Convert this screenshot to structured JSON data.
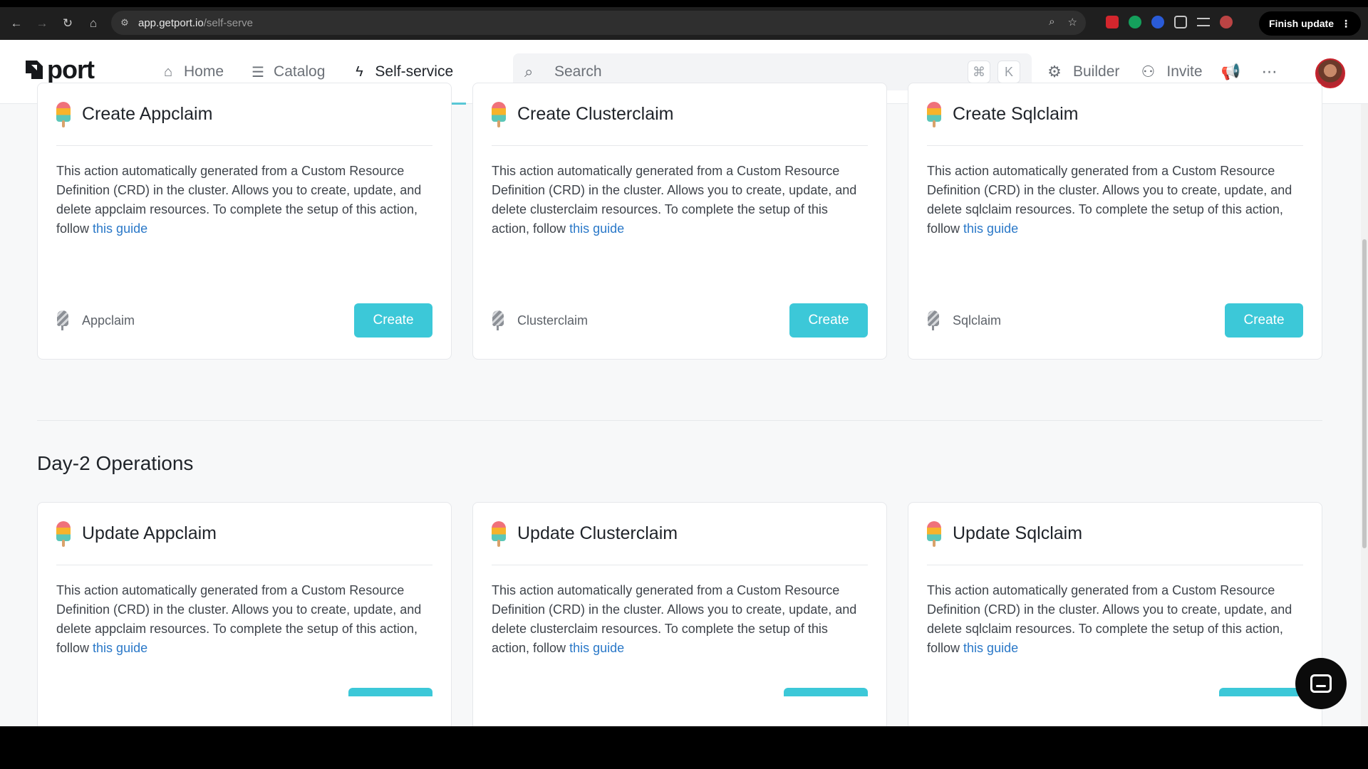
{
  "browser": {
    "url_host": "app.getport.io",
    "url_path": "/self-serve",
    "finish_update_label": "Finish update"
  },
  "app": {
    "logo_text": "port",
    "nav": [
      {
        "label": "Home",
        "icon": "home-icon"
      },
      {
        "label": "Catalog",
        "icon": "catalog-icon"
      },
      {
        "label": "Self-service",
        "icon": "lightning-icon",
        "active": true
      }
    ],
    "search": {
      "placeholder": "Search",
      "shortcut_cmd": "⌘",
      "shortcut_key": "K"
    },
    "builder_label": "Builder",
    "invite_label": "Invite"
  },
  "cards_top": [
    {
      "title": "Create Appclaim",
      "desc": "This action automatically generated from a Custom Resource Definition (CRD) in the cluster. Allows you to create, update, and delete appclaim resources. To complete the setup of this action, follow",
      "link": "this guide",
      "blueprint": "Appclaim",
      "button": "Create"
    },
    {
      "title": "Create Clusterclaim",
      "desc": "This action automatically generated from a Custom Resource Definition (CRD) in the cluster. Allows you to create, update, and delete clusterclaim resources. To complete the setup of this action, follow",
      "link": "this guide",
      "blueprint": "Clusterclaim",
      "button": "Create"
    },
    {
      "title": "Create Sqlclaim",
      "desc": "This action automatically generated from a Custom Resource Definition (CRD) in the cluster. Allows you to create, update, and delete sqlclaim resources. To complete the setup of this action, follow",
      "link": "this guide",
      "blueprint": "Sqlclaim",
      "button": "Create"
    }
  ],
  "section_day2": {
    "title": "Day-2 Operations"
  },
  "cards_bottom": [
    {
      "title": "Update Appclaim",
      "desc": "This action automatically generated from a Custom Resource Definition (CRD) in the cluster. Allows you to create, update, and delete appclaim resources. To complete the setup of this action, follow",
      "link": "this guide"
    },
    {
      "title": "Update Clusterclaim",
      "desc": "This action automatically generated from a Custom Resource Definition (CRD) in the cluster. Allows you to create, update, and delete clusterclaim resources. To complete the setup of this action, follow",
      "link": "this guide"
    },
    {
      "title": "Update Sqlclaim",
      "desc": "This action automatically generated from a Custom Resource Definition (CRD) in the cluster. Allows you to create, update, and delete sqlclaim resources. To complete the setup of this action, follow",
      "link": "this guide"
    }
  ],
  "colors": {
    "accent": "#3cc8d8",
    "link": "#2a78c8",
    "nav_underline": "#58c7d6"
  }
}
